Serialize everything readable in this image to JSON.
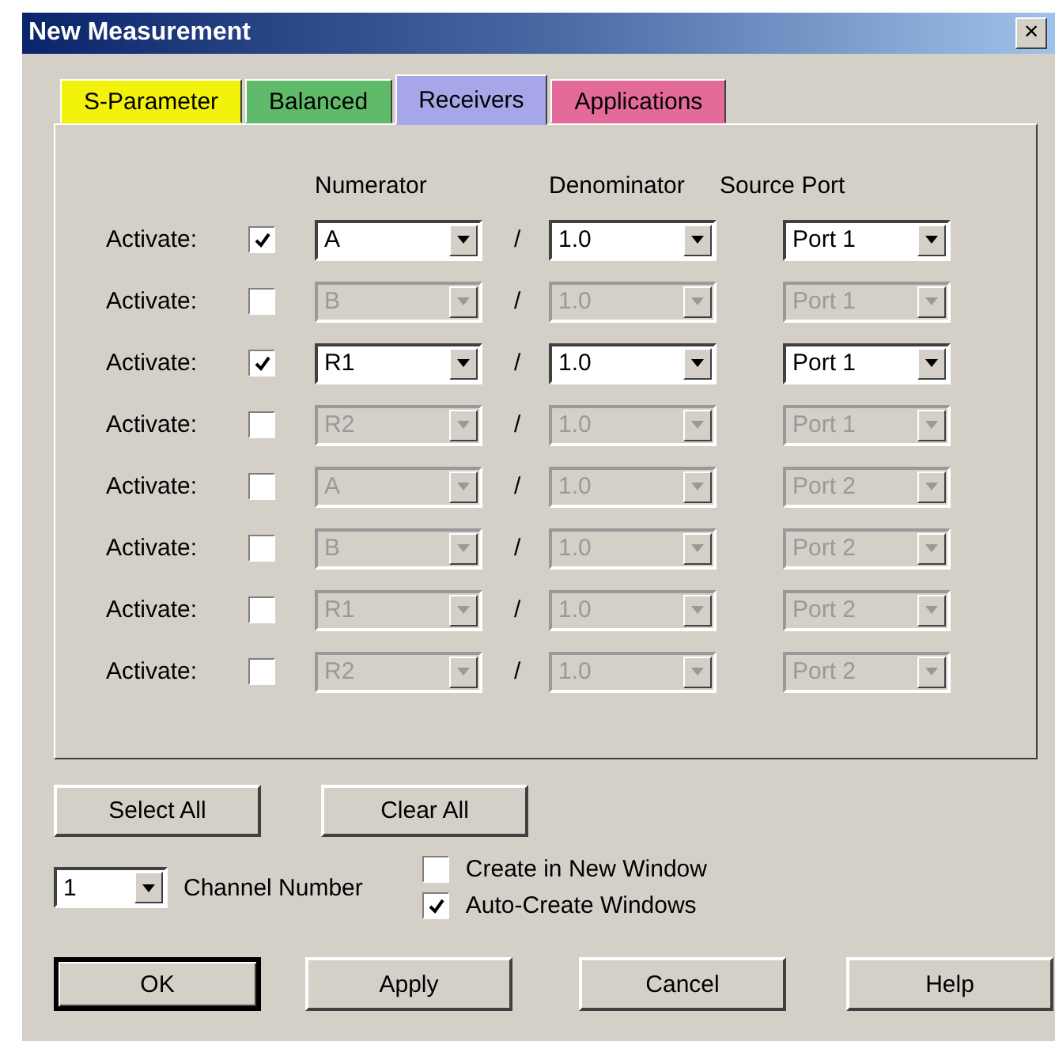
{
  "window": {
    "title": "New Measurement",
    "close": "×"
  },
  "tabs": [
    {
      "label": "S-Parameter",
      "selected": false,
      "color": "#f2f20a"
    },
    {
      "label": "Balanced",
      "selected": false,
      "color": "#5fbb6a"
    },
    {
      "label": "Receivers",
      "selected": true,
      "color": "#a6a6e8"
    },
    {
      "label": "Applications",
      "selected": false,
      "color": "#e46a9a"
    }
  ],
  "columns": [
    "Numerator",
    "Denominator",
    "Source Port"
  ],
  "rows": [
    {
      "label": "Activate:",
      "checked": true,
      "numerator": "A",
      "separator": "/",
      "denominator": "1.0",
      "source_port": "Port 1"
    },
    {
      "label": "Activate:",
      "checked": false,
      "numerator": "B",
      "separator": "/",
      "denominator": "1.0",
      "source_port": "Port 1"
    },
    {
      "label": "Activate:",
      "checked": true,
      "numerator": "R1",
      "separator": "/",
      "denominator": "1.0",
      "source_port": "Port 1"
    },
    {
      "label": "Activate:",
      "checked": false,
      "numerator": "R2",
      "separator": "/",
      "denominator": "1.0",
      "source_port": "Port 1"
    },
    {
      "label": "Activate:",
      "checked": false,
      "numerator": "A",
      "separator": "/",
      "denominator": "1.0",
      "source_port": "Port 2"
    },
    {
      "label": "Activate:",
      "checked": false,
      "numerator": "B",
      "separator": "/",
      "denominator": "1.0",
      "source_port": "Port 2"
    },
    {
      "label": "Activate:",
      "checked": false,
      "numerator": "R1",
      "separator": "/",
      "denominator": "1.0",
      "source_port": "Port 2"
    },
    {
      "label": "Activate:",
      "checked": false,
      "numerator": "R2",
      "separator": "/",
      "denominator": "1.0",
      "source_port": "Port 2"
    }
  ],
  "select_buttons": [
    "Select All",
    "Clear All"
  ],
  "channel": {
    "value": "1",
    "label": "Channel Number"
  },
  "options": [
    {
      "label": "Create in New Window",
      "checked": false
    },
    {
      "label": "Auto-Create Windows",
      "checked": true
    }
  ],
  "buttons": [
    "OK",
    "Apply",
    "Cancel",
    "Help"
  ]
}
